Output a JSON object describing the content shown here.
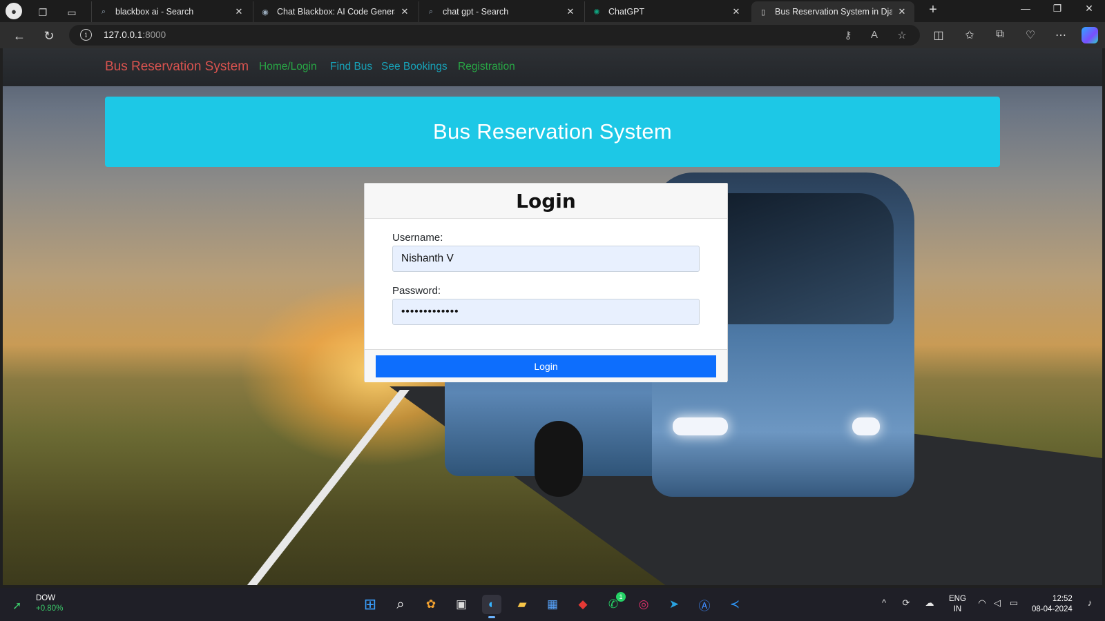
{
  "browser": {
    "tabs": [
      {
        "label": "blackbox ai - Search",
        "favicon": "search-icon"
      },
      {
        "label": "Chat Blackbox: AI Code Generatio",
        "favicon": "blackbox-icon"
      },
      {
        "label": "chat gpt - Search",
        "favicon": "search-icon"
      },
      {
        "label": "ChatGPT",
        "favicon": "chatgpt-icon"
      },
      {
        "label": "Bus Reservation System in Djang",
        "favicon": "page-icon",
        "active": true
      }
    ],
    "address": {
      "host": "127.0.0.1",
      "port": ":8000"
    }
  },
  "navbar": {
    "brand": "Bus Reservation System",
    "links": [
      {
        "label": "Home/Login",
        "color": "#28a745"
      },
      {
        "label": "Find Bus",
        "color": "#17a2b8"
      },
      {
        "label": "See Bookings",
        "color": "#17a2b8"
      },
      {
        "label": "Registration",
        "color": "#28a745"
      }
    ]
  },
  "hero": {
    "title": "Bus Reservation System"
  },
  "login": {
    "title": "Login",
    "username_label": "Username:",
    "username_value": "Nishanth V",
    "password_label": "Password:",
    "password_value": "•••••••••••••",
    "submit_label": "Login"
  },
  "taskbar": {
    "widget": {
      "name": "DOW",
      "change": "+0.80%"
    },
    "lang": {
      "line1": "ENG",
      "line2": "IN"
    },
    "clock": {
      "time": "12:52",
      "date": "08-04-2024"
    },
    "whatsapp_badge": "1"
  },
  "colors": {
    "brand": "#d9534f",
    "hero": "#1dc8e6",
    "primary": "#0d6efd"
  }
}
